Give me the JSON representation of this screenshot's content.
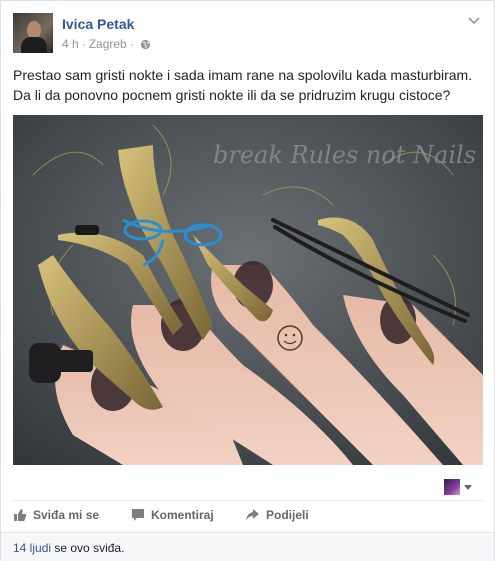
{
  "post": {
    "author": "Ivica Petak",
    "time": "4 h",
    "separator1": "·",
    "location": "Zagreb",
    "separator2": "·",
    "privacy_icon": "globe-icon",
    "text_line1": "Prestao sam gristi nokte i sada imam rane na spolovilu kada masturbiram.",
    "text_line2": "Da li da ponovno pocnem gristi nokte ili da se pridruzim krugu cistoce?",
    "image_watermark": "break Rules not Nails"
  },
  "actions": {
    "like_label": "Sviđa mi se",
    "like_icon": "thumbs-up-icon",
    "comment_label": "Komentiraj",
    "comment_icon": "speech-bubble-icon",
    "share_label": "Podijeli",
    "share_icon": "share-arrow-icon"
  },
  "likes": {
    "count_link": "14 ljudi",
    "suffix": "se ovo sviđa."
  },
  "colors": {
    "link": "#365899",
    "meta": "#90949c",
    "action": "#616770"
  }
}
